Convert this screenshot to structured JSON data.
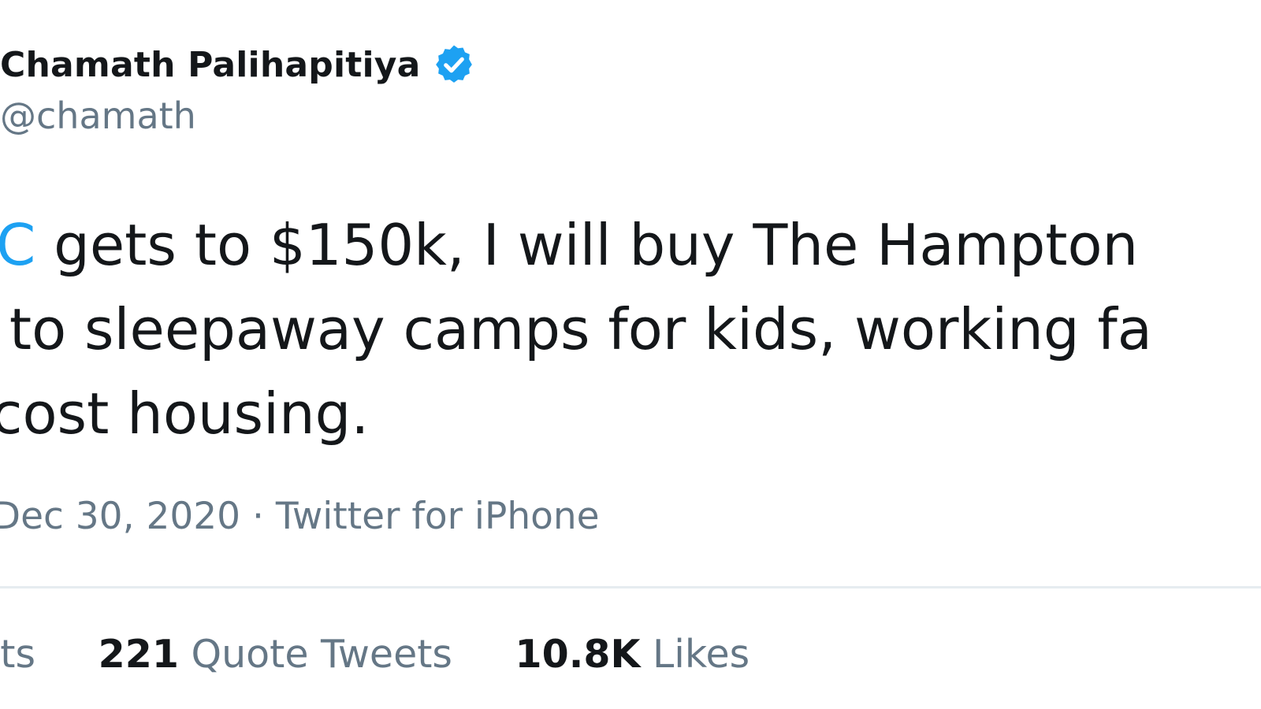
{
  "author": {
    "name": "Chamath Palihapitiya",
    "handle": "@chamath",
    "verified_color": "#1da1f2"
  },
  "tweet": {
    "line1_prefix": "",
    "cashtag": "$BTC",
    "line1_suffix": " gets to $150k, I will buy The Hampton",
    "line2": "rt it to sleepaway camps for kids, working fa",
    "line3": "ow-cost housing."
  },
  "meta": {
    "text": "· Dec 30, 2020 · Twitter for iPhone"
  },
  "stats": {
    "retweets_label": "eets",
    "quote_count": "221",
    "quote_label": " Quote Tweets",
    "likes_count": "10.8K",
    "likes_label": " Likes"
  },
  "colors": {
    "text": "#14171a",
    "secondary": "#657786",
    "accent": "#1da1f2",
    "divider": "#e6ecf0"
  }
}
